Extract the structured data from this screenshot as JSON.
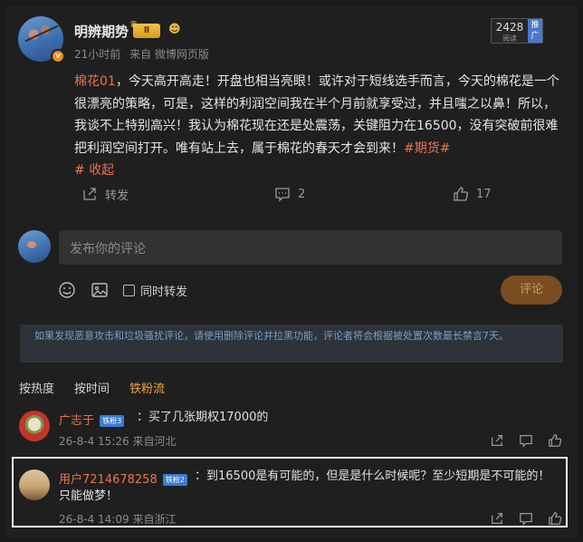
{
  "post": {
    "username": "明辨期势",
    "rank_label": "Ⅱ",
    "time": "21小时前",
    "source": "来自 微博网页版",
    "read_count": "2428",
    "read_label": "阅读",
    "promote_label": "推广",
    "topic": "棉花01",
    "body": "，今天高开高走！开盘也相当亮眼！或许对于短线选手而言，今天的棉花是一个很漂亮的策略，可是，这样的利润空间我在半个月前就享受过，并且嗤之以鼻！所以，我谈不上特别高兴！我认为棉花现在还是处震荡，关键阻力在16500，没有突破前很难把利润空间打开。唯有站上去，属于棉花的春天才会到来！",
    "hashtag": "#期货#",
    "collapse": "收起"
  },
  "actions": {
    "repost_label": "转发",
    "comment_count": "2",
    "like_count": "17"
  },
  "composer": {
    "placeholder": "发布你的评论",
    "repost_check_label": "同时转发",
    "submit_label": "评论"
  },
  "notice": "如果发现恶意攻击和垃圾骚扰评论，请使用删除评论并拉黑功能，评论者将会根据被处置次数最长禁言7天。",
  "tabs": [
    "按热度",
    "按时间",
    "铁粉流"
  ],
  "comments": [
    {
      "name": "广志于",
      "badge": "铁粉3",
      "text": "：买了几张期权17000的",
      "date": "26-8-4 15:26",
      "location": "来自河北"
    },
    {
      "name": "用户7214678258",
      "badge": "铁粉2",
      "text": "：到16500是有可能的，但是是什么时候呢？至少短期是不可能的！只能做梦！",
      "date": "26-8-4 14:09",
      "location": "来自浙江"
    }
  ],
  "colors": {
    "accent": "#eb7350",
    "tab_active": "#f0a53c",
    "submit_bg": "#7a4d22",
    "notice_text": "#7a9ec6"
  }
}
